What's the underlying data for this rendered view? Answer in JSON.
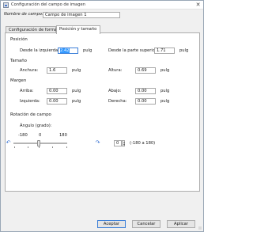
{
  "window": {
    "title": "Configuración del campo de imagen",
    "icon": "image-field-icon",
    "close_glyph": "✕"
  },
  "field_name": {
    "label": "Nombre de campo:",
    "value": "Campo de imagen 1"
  },
  "tabs": [
    {
      "label": "Configuración de formato",
      "active": false
    },
    {
      "label": "Posición y tamaño",
      "active": true
    }
  ],
  "position": {
    "heading": "Posición",
    "from_left_label": "Desde la izquierda:",
    "from_left_value": "2.42",
    "from_left_unit": "pulg",
    "from_top_label": "Desde la parte superior:",
    "from_top_value": "1.71",
    "from_top_unit": "pulg"
  },
  "size": {
    "heading": "Tamaño",
    "width_label": "Anchura:",
    "width_value": "1.6",
    "width_unit": "pulg",
    "height_label": "Altura:",
    "height_value": "0.69",
    "height_unit": "pulg"
  },
  "margin": {
    "heading": "Margen",
    "top_label": "Arriba:",
    "top_value": "0.00",
    "top_unit": "pulg",
    "bottom_label": "Abajo:",
    "bottom_value": "0.00",
    "bottom_unit": "pulg",
    "left_label": "Izquierda:",
    "left_value": "0.00",
    "left_unit": "pulg",
    "right_label": "Derecha:",
    "right_value": "0.00",
    "right_unit": "pulg"
  },
  "rotation": {
    "heading": "Rotación de campo",
    "angle_label": "Ángulo (grado):",
    "slider_min": "-180",
    "slider_mid": "0",
    "slider_max": "180",
    "slider_value": 0,
    "angle_value": "0",
    "range_hint": "(-180 a 180)",
    "rotate_left_glyph": "↶",
    "rotate_right_glyph": "↷"
  },
  "buttons": {
    "accept": "Aceptar",
    "cancel": "Cancelar",
    "apply": "Aplicar"
  },
  "colors": {
    "accent": "#3c7fd8",
    "selection": "#3399ff"
  }
}
